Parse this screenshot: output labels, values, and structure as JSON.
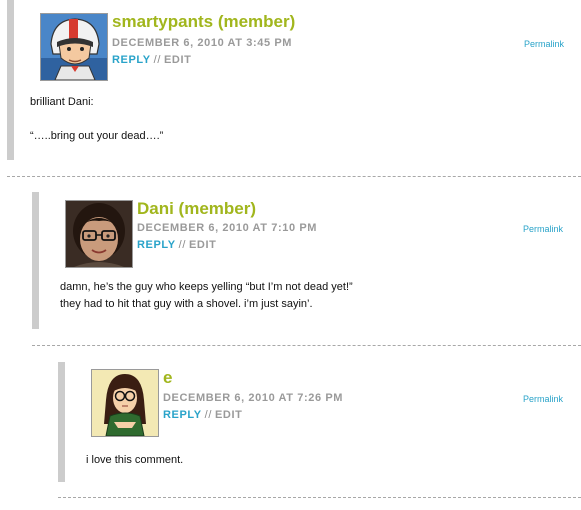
{
  "comments": [
    {
      "author": "smartypants (member)",
      "date": "DECEMBER 6, 2010 AT 3:45 PM",
      "reply": "REPLY",
      "separator": "//",
      "edit": "EDIT",
      "permalink": "Permalink",
      "lines": [
        "brilliant Dani:",
        "“…..bring out your dead….”"
      ],
      "avatar_icon": "helmeted-racer-avatar-icon"
    },
    {
      "author": "Dani (member)",
      "date": "DECEMBER 6, 2010 AT 7:10 PM",
      "reply": "REPLY",
      "separator": "//",
      "edit": "EDIT",
      "permalink": "Permalink",
      "lines": [
        "damn, he’s the guy who keeps yelling “but I’m not dead yet!”",
        "they had to hit that guy with a shovel. i’m just sayin’."
      ],
      "avatar_icon": "glasses-portrait-avatar-icon"
    },
    {
      "author": "e",
      "date": "DECEMBER 6, 2010 AT 7:26 PM",
      "reply": "REPLY",
      "separator": "//",
      "edit": "EDIT",
      "permalink": "Permalink",
      "lines": [
        "i love this comment."
      ],
      "avatar_icon": "cartoon-girl-avatar-icon"
    }
  ],
  "colors": {
    "author": "#a1b61d",
    "link": "#29a3c9",
    "meta": "#9a9a9a",
    "bar": "#cccccc"
  }
}
